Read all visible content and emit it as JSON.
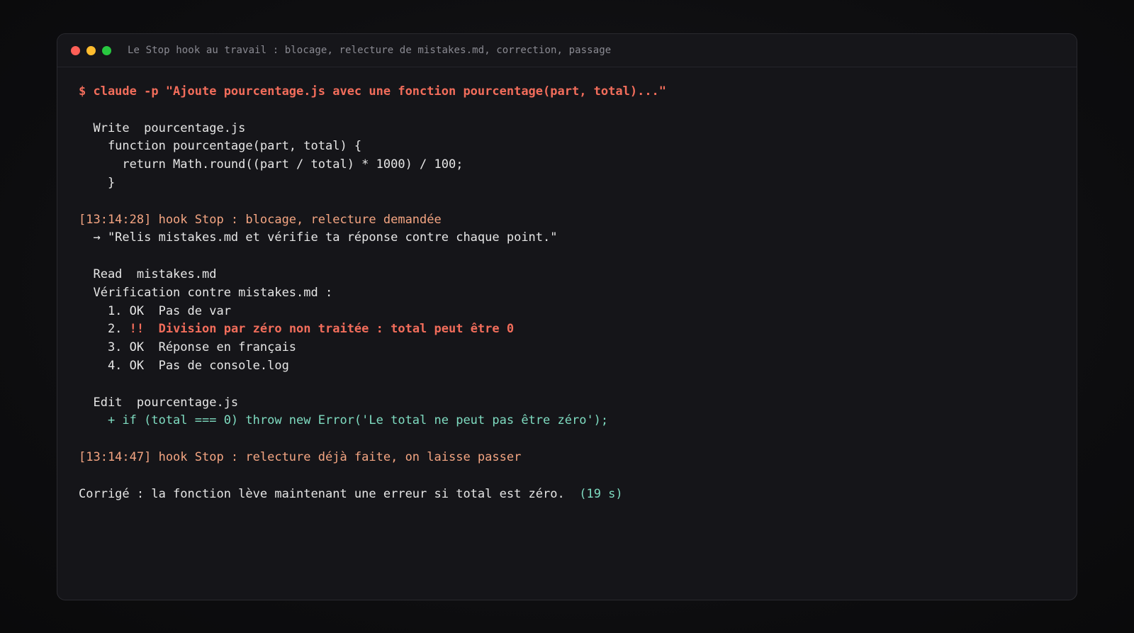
{
  "window": {
    "title": "Le Stop hook au travail : blocage, relecture de mistakes.md, correction, passage",
    "colors": {
      "close": "#ff5f57",
      "minimize": "#febc2e",
      "maximize": "#28c840",
      "command": "#f26d5b",
      "hook": "#f4a582",
      "error": "#f26d5b",
      "diff_add": "#7fdcc1"
    }
  },
  "terminal": {
    "command": "$ claude -p \"Ajoute pourcentage.js avec une fonction pourcentage(part, total)...\"",
    "write_header": "  Write  pourcentage.js",
    "code_line_1": "    function pourcentage(part, total) {",
    "code_line_2": "      return Math.round((part / total) * 1000) / 100;",
    "code_line_3": "    }",
    "hook1": "[13:14:28] hook Stop : blocage, relecture demandée",
    "hook1_reason": "  → \"Relis mistakes.md et vérifie ta réponse contre chaque point.\"",
    "read_header": "  Read  mistakes.md",
    "verify_header": "  Vérification contre mistakes.md :",
    "check1": "    1. OK  Pas de var",
    "check2_prefix": "    2. ",
    "check2_flag": "!!  Division par zéro non traitée : total peut être 0",
    "check3": "    3. OK  Réponse en français",
    "check4": "    4. OK  Pas de console.log",
    "edit_header": "  Edit  pourcentage.js",
    "edit_diff": "    + if (total === 0) throw new Error('Le total ne peut pas être zéro');",
    "hook2": "[13:14:47] hook Stop : relecture déjà faite, on laisse passer",
    "result": "Corrigé : la fonction lève maintenant une erreur si total est zéro.  ",
    "duration": "(19 s)"
  }
}
